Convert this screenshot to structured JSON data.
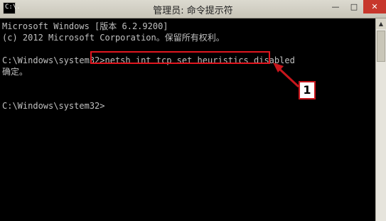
{
  "window": {
    "title": "管理员: 命令提示符",
    "icon_label": "C:\\.",
    "buttons": {
      "minimize": "—",
      "maximize": "□",
      "close": "✕"
    }
  },
  "console": {
    "lines": [
      "Microsoft Windows [版本 6.2.9200]",
      "(c) 2012 Microsoft Corporation。保留所有权利。",
      "",
      "C:\\Windows\\system32>netsh int tcp set heuristics disabled",
      "确定。",
      "",
      "",
      "C:\\Windows\\system32>"
    ],
    "colors": {
      "background": "#000000",
      "text": "#c0c0c0"
    }
  },
  "annotation": {
    "callout_number": "1",
    "highlight_color": "#e1161f"
  }
}
